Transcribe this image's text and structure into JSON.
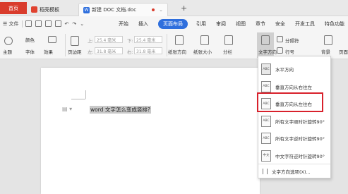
{
  "tabs": {
    "home": "首页",
    "docer": "稻壳模板",
    "doc": "新建 DOC 文档.doc",
    "plus": "+"
  },
  "menubar": {
    "file": "☰ 文件",
    "menus": [
      "开始",
      "插入",
      "页面布局",
      "引用",
      "审阅",
      "视图",
      "章节",
      "安全",
      "开发工具",
      "特色功能"
    ],
    "active_index": 2
  },
  "ribbon": {
    "theme": "主题",
    "color": "颜色",
    "font": "字体",
    "effect": "效果",
    "margin": "页边距",
    "top_label": "上:",
    "top_value": "25.4 毫米",
    "bottom_label": "下:",
    "bottom_value": "25.4 毫米",
    "left_label": "左:",
    "left_value": "31.8 毫米",
    "right_label": "右:",
    "right_value": "31.8 毫米",
    "orientation": "纸张方向",
    "size": "纸张大小",
    "columns": "分栏",
    "text_direction": "文字方向",
    "separator": "分隔符",
    "line_number": "行号",
    "background": "背景",
    "page_border": "页面"
  },
  "document": {
    "selected_text": "word 文字怎么变成竖排?"
  },
  "dropdown": {
    "items": [
      {
        "label": "水平方向",
        "icon": "ABC"
      },
      {
        "label": "垂直方向从右往左",
        "icon": "ABC"
      },
      {
        "label": "垂直方向从左往右",
        "icon": "ABC"
      },
      {
        "label": "所有文字顺时针旋转90°",
        "icon": "ABC"
      },
      {
        "label": "所有文字逆时针旋转90°",
        "icon": "ABC"
      },
      {
        "label": "中文字符逆时针旋转90°",
        "icon": "中文"
      }
    ],
    "options_label": "文字方向选项(X)..."
  },
  "colors": {
    "home_tab": "#d93c2c",
    "active_menu": "#2f6fdd",
    "highlight": "#d8212c"
  }
}
